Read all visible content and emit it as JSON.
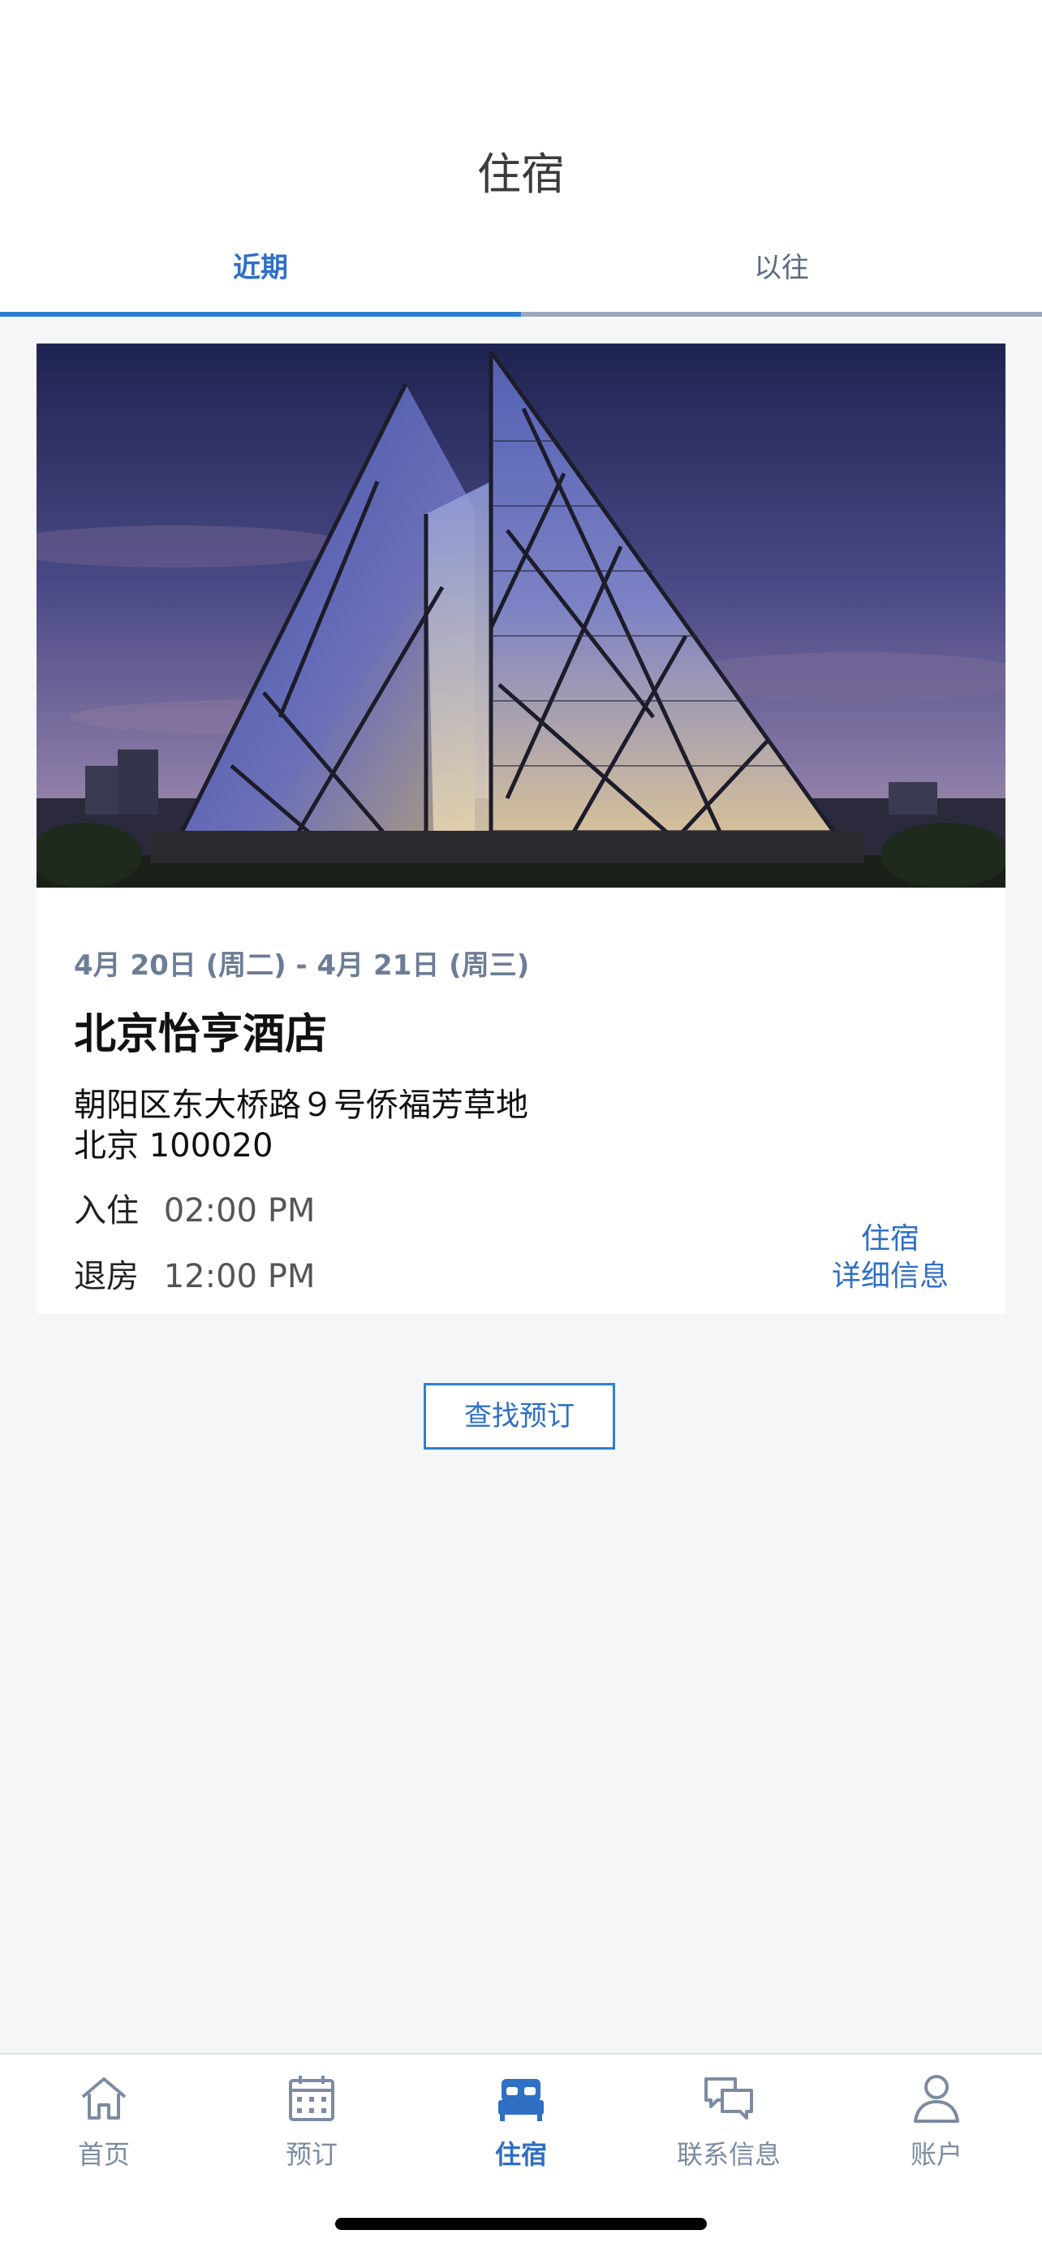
{
  "header": {
    "title": "住宿"
  },
  "tabs": [
    {
      "label": "近期"
    },
    {
      "label": "以往"
    }
  ],
  "stay": {
    "dates": "4月 20日 (周二) - 4月 21日 (周三)",
    "hotel_name": "北京怡亨酒店",
    "address_line1": "朝阳区东大桥路９号侨福芳草地",
    "address_line2": "北京 100020",
    "checkin_label": "入住",
    "checkin_time": "02:00 PM",
    "checkout_label": "退房",
    "checkout_time": "12:00 PM",
    "details_link_line1": "住宿",
    "details_link_line2": "详细信息"
  },
  "actions": {
    "find_booking": "查找预订"
  },
  "bottom_nav": [
    {
      "label": "首页",
      "icon": "home-icon"
    },
    {
      "label": "预订",
      "icon": "calendar-icon"
    },
    {
      "label": "住宿",
      "icon": "bed-icon"
    },
    {
      "label": "联系信息",
      "icon": "chat-icon"
    },
    {
      "label": "账户",
      "icon": "person-icon"
    }
  ],
  "colors": {
    "accent": "#2f6fc4",
    "tab_active_underline": "#2f7fd1",
    "nav_inactive": "#7c8ba1",
    "date_text": "#6c7d96"
  }
}
